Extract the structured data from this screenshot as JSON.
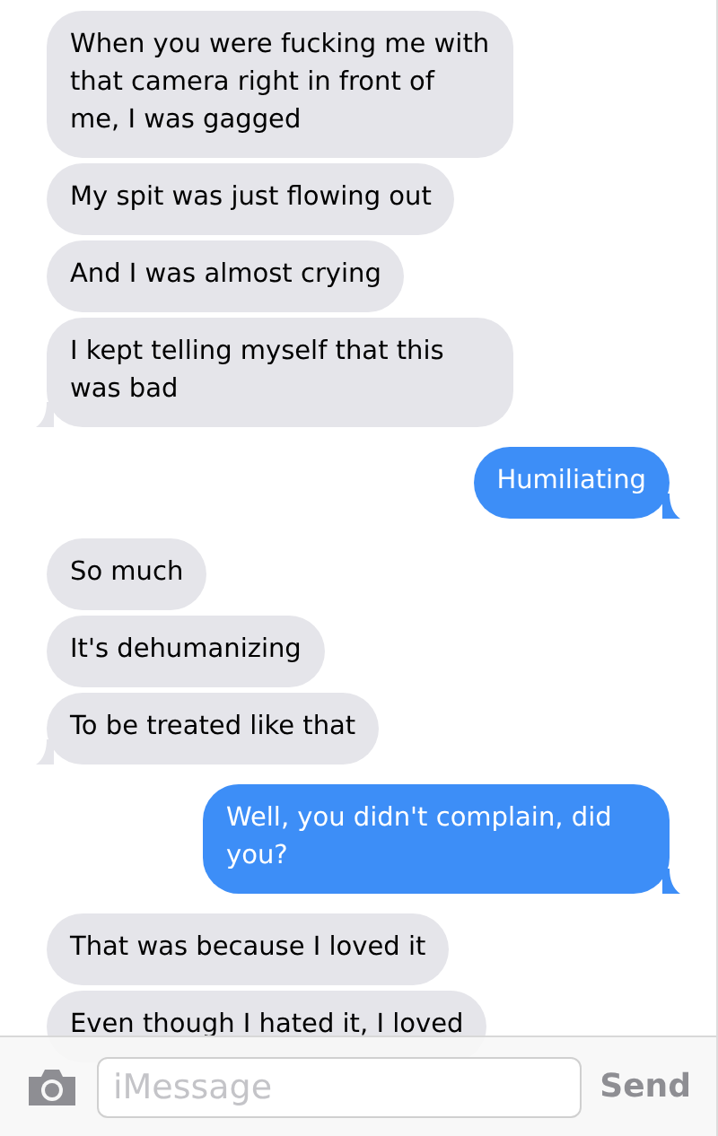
{
  "messages": [
    {
      "kind": "received",
      "text": "When you were fucking me with that camera right in front of me, I was gagged",
      "tail": false
    },
    {
      "kind": "received",
      "text": "My spit was just flowing out",
      "tail": false
    },
    {
      "kind": "received",
      "text": "And I was almost crying",
      "tail": false
    },
    {
      "kind": "received",
      "text": "I kept telling myself that this was bad",
      "tail": true
    },
    {
      "kind": "sent",
      "text": "Humiliating",
      "tail": true
    },
    {
      "kind": "received",
      "text": "So much",
      "tail": false
    },
    {
      "kind": "received",
      "text": "It's dehumanizing",
      "tail": false
    },
    {
      "kind": "received",
      "text": "To be treated like that",
      "tail": true
    },
    {
      "kind": "sent",
      "text": "Well, you didn't complain, did you?",
      "tail": true
    },
    {
      "kind": "received",
      "text": "That was because I loved it",
      "tail": false
    },
    {
      "kind": "received",
      "text": "Even though I hated it, I loved"
    }
  ],
  "composer": {
    "placeholder": "iMessage",
    "send": "Send"
  }
}
